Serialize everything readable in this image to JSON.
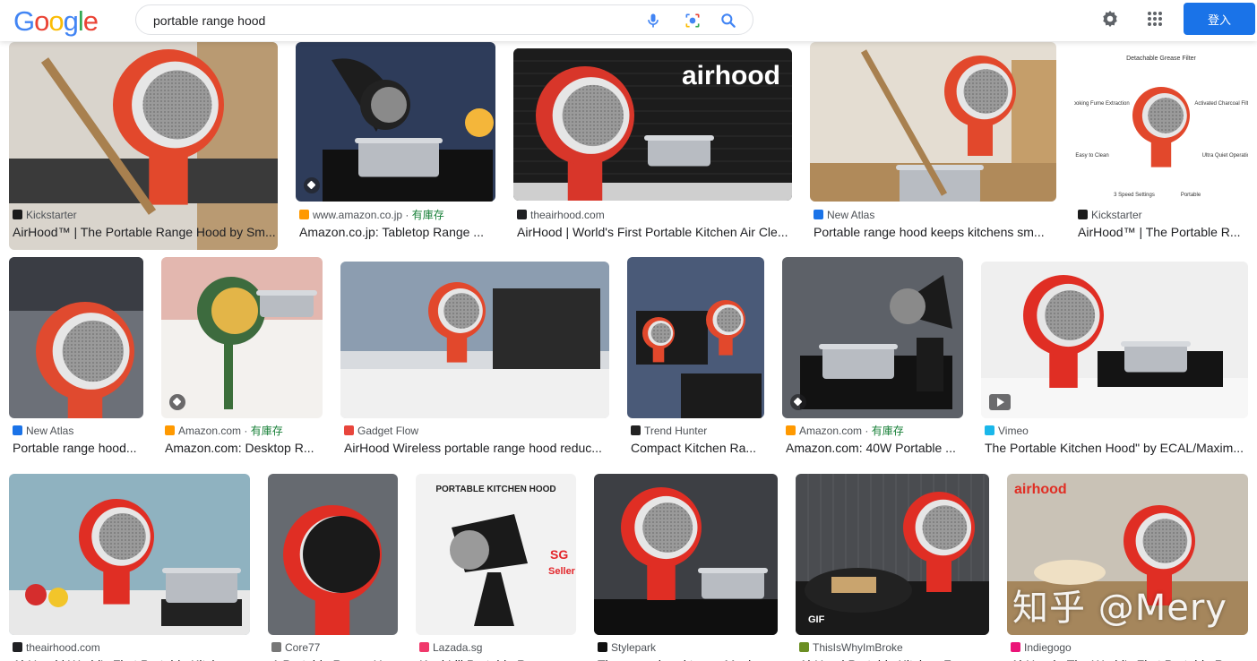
{
  "header": {
    "logo_letters": [
      "G",
      "o",
      "o",
      "g",
      "l",
      "e"
    ],
    "logo_colors": [
      "#4285F4",
      "#EA4335",
      "#FBBC05",
      "#4285F4",
      "#34A853",
      "#EA4335"
    ],
    "search_value": "portable range hood",
    "signin_label": "登入",
    "accent": "#1a73e8"
  },
  "rows": [
    [
      {
        "source": "Kickstarter",
        "stock": "",
        "title": "AirHood™ | The Portable Range Hood by Sm...",
        "icon": "kickstarter-icon"
      },
      {
        "source": "www.amazon.co.jp",
        "stock": "有庫存",
        "title": "Amazon.co.jp: Tabletop Range ...",
        "icon": "amazon-icon"
      },
      {
        "source": "theairhood.com",
        "stock": "",
        "title": "AirHood | World's First Portable Kitchen Air Cle...",
        "icon": "airhood-icon"
      },
      {
        "source": "New Atlas",
        "stock": "",
        "title": "Portable range hood keeps kitchens sm...",
        "icon": "newatlas-icon"
      },
      {
        "source": "Kickstarter",
        "stock": "",
        "title": "AirHood™ | The Portable R...",
        "icon": "kickstarter-icon"
      }
    ],
    [
      {
        "source": "New Atlas",
        "stock": "",
        "title": "Portable range hood...",
        "icon": "newatlas-icon"
      },
      {
        "source": "Amazon.com",
        "stock": "有庫存",
        "title": "Amazon.com: Desktop R...",
        "icon": "amazon-icon"
      },
      {
        "source": "Gadget Flow",
        "stock": "",
        "title": "AirHood Wireless portable range hood reduc...",
        "icon": "gadgetflow-icon"
      },
      {
        "source": "Trend Hunter",
        "stock": "",
        "title": "Compact Kitchen Ra...",
        "icon": "trendhunter-icon"
      },
      {
        "source": "Amazon.com",
        "stock": "有庫存",
        "title": "Amazon.com: 40W Portable ...",
        "icon": "amazon-icon"
      },
      {
        "source": "Vimeo",
        "stock": "",
        "title": "The Portable Kitchen Hood\" by ECAL/Maxim...",
        "icon": "vimeo-icon"
      }
    ],
    [
      {
        "source": "theairhood.com",
        "stock": "",
        "title": "AirHood | World's First Portable Kitch...",
        "icon": "airhood-icon"
      },
      {
        "source": "Core77",
        "stock": "",
        "title": "A Portable Range Hoo...",
        "icon": "core77-icon"
      },
      {
        "source": "Lazada.sg",
        "stock": "",
        "title": "Kopi Lili Portable Ra...",
        "icon": "lazada-icon"
      },
      {
        "source": "Stylepark",
        "stock": "",
        "title": "The range hood to go: Maxi...",
        "icon": "stylepark-icon"
      },
      {
        "source": "ThisIsWhyImBroke",
        "stock": "",
        "title": "AirHood Portable Kitchen Fu...",
        "icon": "thisiswhyimbroke-icon"
      },
      {
        "source": "Indiegogo",
        "stock": "",
        "title": "AirHood - The World's First Portable Ra...",
        "icon": "indiegogo-icon"
      }
    ]
  ],
  "image_text": {
    "airhood_brand": "airhood",
    "kickstarter_features": [
      "Detachable Grease Filter",
      "Cooking Fume Extraction",
      "Activated Charcoal Filter",
      "Easy to Clean",
      "Ultra Quiet Operation",
      "3 Speed Settings",
      "Portable"
    ],
    "lazada_heading": "PORTABLE KITCHEN HOOD",
    "lazada_tag": "SG Seller",
    "gif_label": "GIF",
    "indiegogo_brand": "airhood"
  },
  "watermark": "知乎 @Mery"
}
